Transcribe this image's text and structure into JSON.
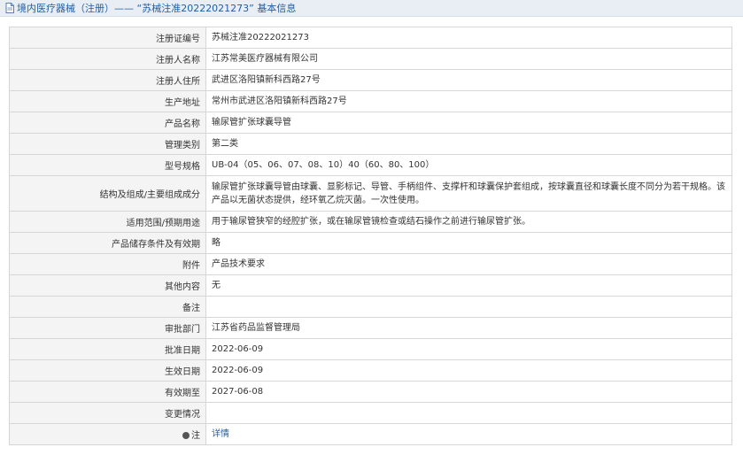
{
  "header": {
    "title": "境内医疗器械（注册）—— “苏械注准20222021273” 基本信息"
  },
  "rows": [
    {
      "label": "注册证编号",
      "value": "苏械注准20222021273"
    },
    {
      "label": "注册人名称",
      "value": "江苏常美医疗器械有限公司"
    },
    {
      "label": "注册人住所",
      "value": "武进区洛阳镇新科西路27号"
    },
    {
      "label": "生产地址",
      "value": "常州市武进区洛阳镇新科西路27号"
    },
    {
      "label": "产品名称",
      "value": "输尿管扩张球囊导管"
    },
    {
      "label": "管理类别",
      "value": "第二类"
    },
    {
      "label": "型号规格",
      "value": "UB-04（05、06、07、08、10）40（60、80、100）"
    },
    {
      "label": "结构及组成/主要组成成分",
      "value": "输尿管扩张球囊导管由球囊、显影标记、导管、手柄组件、支撑杆和球囊保护套组成，按球囊直径和球囊长度不同分为若干规格。该产品以无菌状态提供，经环氧乙烷灭菌。一次性使用。"
    },
    {
      "label": "适用范围/预期用途",
      "value": "用于输尿管狭窄的经腔扩张，或在输尿管镜检查或结石操作之前进行输尿管扩张。"
    },
    {
      "label": "产品储存条件及有效期",
      "value": "略"
    },
    {
      "label": "附件",
      "value": "产品技术要求"
    },
    {
      "label": "其他内容",
      "value": "无"
    },
    {
      "label": "备注",
      "value": ""
    },
    {
      "label": "审批部门",
      "value": "江苏省药品监督管理局"
    },
    {
      "label": "批准日期",
      "value": "2022-06-09"
    },
    {
      "label": "生效日期",
      "value": "2022-06-09"
    },
    {
      "label": "有效期至",
      "value": "2027-06-08"
    },
    {
      "label": "变更情况",
      "value": ""
    },
    {
      "label": "注",
      "value": "详情"
    }
  ],
  "icons": {
    "title": "document-icon",
    "note": "note-dot-icon"
  },
  "colors": {
    "title": "#1f5fa8",
    "link": "#1f5fa8",
    "label_bg": "#f4f4f4",
    "border": "#d6d6d6"
  }
}
